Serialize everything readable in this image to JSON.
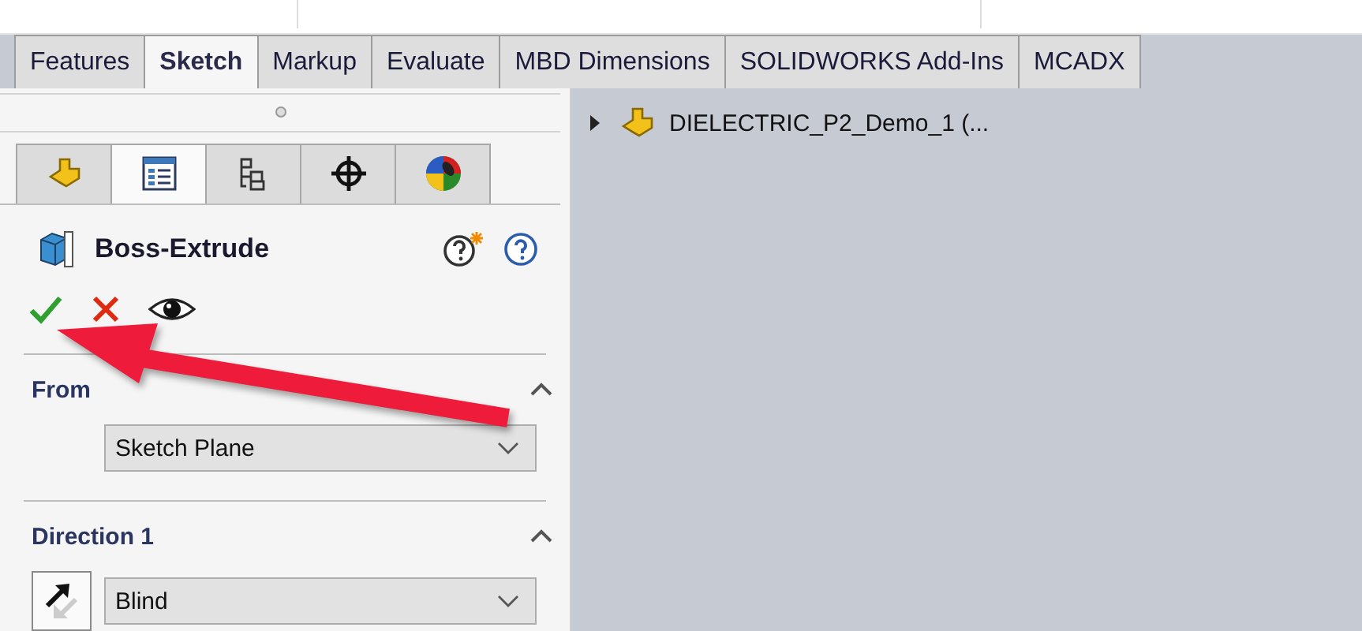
{
  "command_tabs": [
    {
      "label": "Features",
      "selected": false
    },
    {
      "label": "Sketch",
      "selected": true
    },
    {
      "label": "Markup",
      "selected": false
    },
    {
      "label": "Evaluate",
      "selected": false
    },
    {
      "label": "MBD Dimensions",
      "selected": false
    },
    {
      "label": "SOLIDWORKS Add-Ins",
      "selected": false
    },
    {
      "label": "MCADX",
      "selected": false
    }
  ],
  "property_manager": {
    "view_tabs": [
      {
        "kind": "feature",
        "selected": false
      },
      {
        "kind": "property",
        "selected": true
      },
      {
        "kind": "config",
        "selected": false
      },
      {
        "kind": "target",
        "selected": false
      },
      {
        "kind": "display",
        "selected": false
      }
    ],
    "title": "Boss-Extrude",
    "sections": [
      {
        "kind": "from",
        "title": "From",
        "expanded": true,
        "select": "Sketch Plane"
      },
      {
        "kind": "direction",
        "title": "Direction 1",
        "expanded": true,
        "select": "Blind"
      }
    ]
  },
  "tree": {
    "items": [
      {
        "label": "DIELECTRIC_P2_Demo_1 (...",
        "expanded": false
      }
    ]
  }
}
